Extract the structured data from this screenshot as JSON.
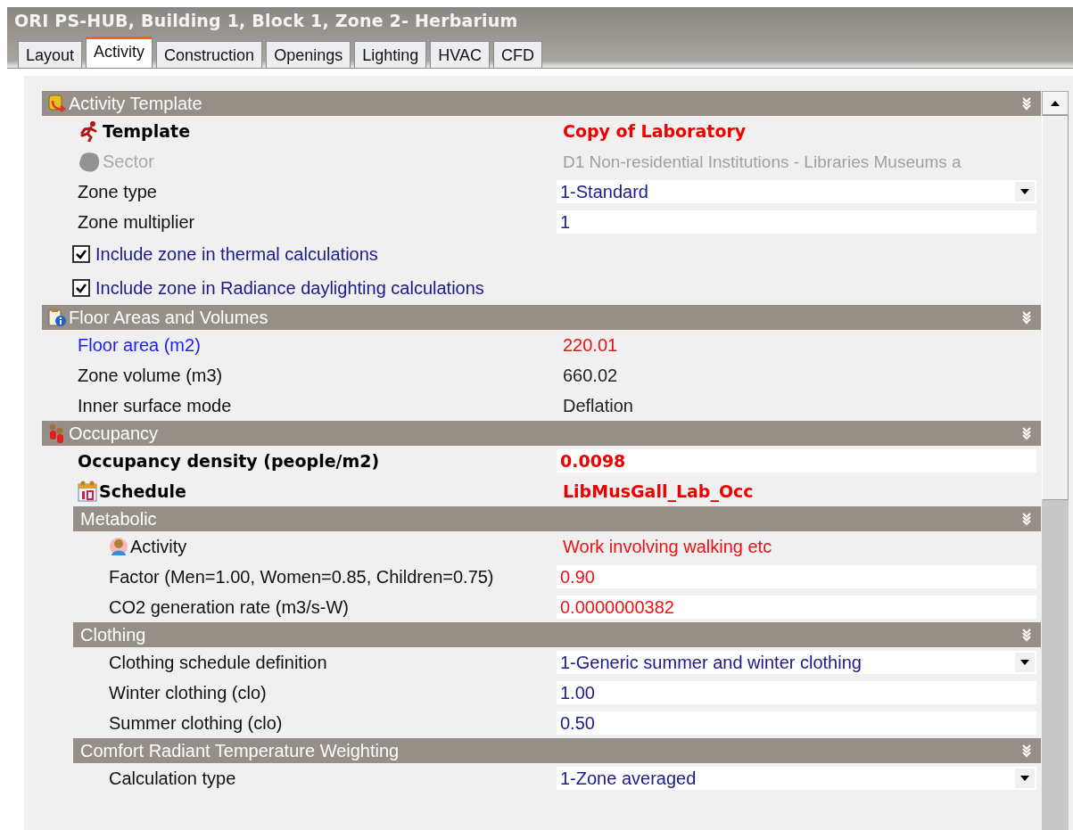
{
  "window": {
    "title": "ORI PS-HUB, Building 1, Block 1, Zone 2- Herbarium"
  },
  "tabs": [
    {
      "label": "Layout",
      "selected": false
    },
    {
      "label": "Activity",
      "selected": true
    },
    {
      "label": "Construction",
      "selected": false
    },
    {
      "label": "Openings",
      "selected": false
    },
    {
      "label": "Lighting",
      "selected": false
    },
    {
      "label": "HVAC",
      "selected": false
    },
    {
      "label": "CFD",
      "selected": false
    }
  ],
  "sections": [
    {
      "title": "Activity Template",
      "rows": [
        {
          "kind": "key",
          "label": "Template",
          "value": "Copy of Laboratory",
          "color": "#ee0000"
        },
        {
          "kind": "plain",
          "label": "Sector",
          "value": "D1 Non-residential Institutions - Libraries Museums a",
          "disabled": true,
          "color": "#a0a0a0"
        },
        {
          "kind": "select",
          "label": "Zone type",
          "value": "1-Standard",
          "color": "#1a1a8c"
        },
        {
          "kind": "field",
          "label": "Zone multiplier",
          "value": "1",
          "color": "#1a1a8c"
        },
        {
          "kind": "checkbox",
          "label": "Include zone in thermal calculations",
          "checked": true
        },
        {
          "kind": "checkbox",
          "label": "Include zone in Radiance daylighting calculations",
          "checked": true
        }
      ]
    },
    {
      "title": "Floor Areas and Volumes",
      "rows": [
        {
          "kind": "link",
          "label": "Floor area (m2)",
          "value": "220.01",
          "color": "#ee1111"
        },
        {
          "kind": "plain",
          "label": "Zone volume (m3)",
          "value": "660.02",
          "color": "#222222"
        },
        {
          "kind": "plain",
          "label": "Inner surface mode",
          "value": "Deflation",
          "color": "#222222"
        }
      ]
    },
    {
      "title": "Occupancy",
      "rows": [
        {
          "kind": "key-field",
          "label": "Occupancy density (people/m2)",
          "value": "0.0098",
          "color": "#ee0000"
        },
        {
          "kind": "key",
          "label": "Schedule",
          "value": "LibMusGall_Lab_Occ",
          "color": "#ee0000"
        }
      ],
      "children": [
        {
          "title": "Metabolic",
          "rows": [
            {
              "kind": "plain",
              "label": "Activity",
              "value": "Work involving walking etc",
              "color": "#ee1111"
            },
            {
              "kind": "field",
              "label": "Factor (Men=1.00, Women=0.85, Children=0.75)",
              "value": "0.90",
              "color": "#ee1111"
            },
            {
              "kind": "field",
              "label": "CO2 generation rate (m3/s-W)",
              "value": "0.0000000382",
              "color": "#ee1111"
            }
          ]
        },
        {
          "title": "Clothing",
          "rows": [
            {
              "kind": "select",
              "label": "Clothing schedule definition",
              "value": "1-Generic summer and winter clothing",
              "color": "#1a1a8c"
            },
            {
              "kind": "field",
              "label": "Winter clothing (clo)",
              "value": "1.00",
              "color": "#1a1a8c"
            },
            {
              "kind": "field",
              "label": "Summer clothing (clo)",
              "value": "0.50",
              "color": "#1a1a8c"
            }
          ]
        },
        {
          "title": "Comfort Radiant Temperature Weighting",
          "rows": [
            {
              "kind": "select",
              "label": "Calculation type",
              "value": "1-Zone averaged",
              "color": "#1a1a8c"
            }
          ]
        }
      ]
    }
  ]
}
